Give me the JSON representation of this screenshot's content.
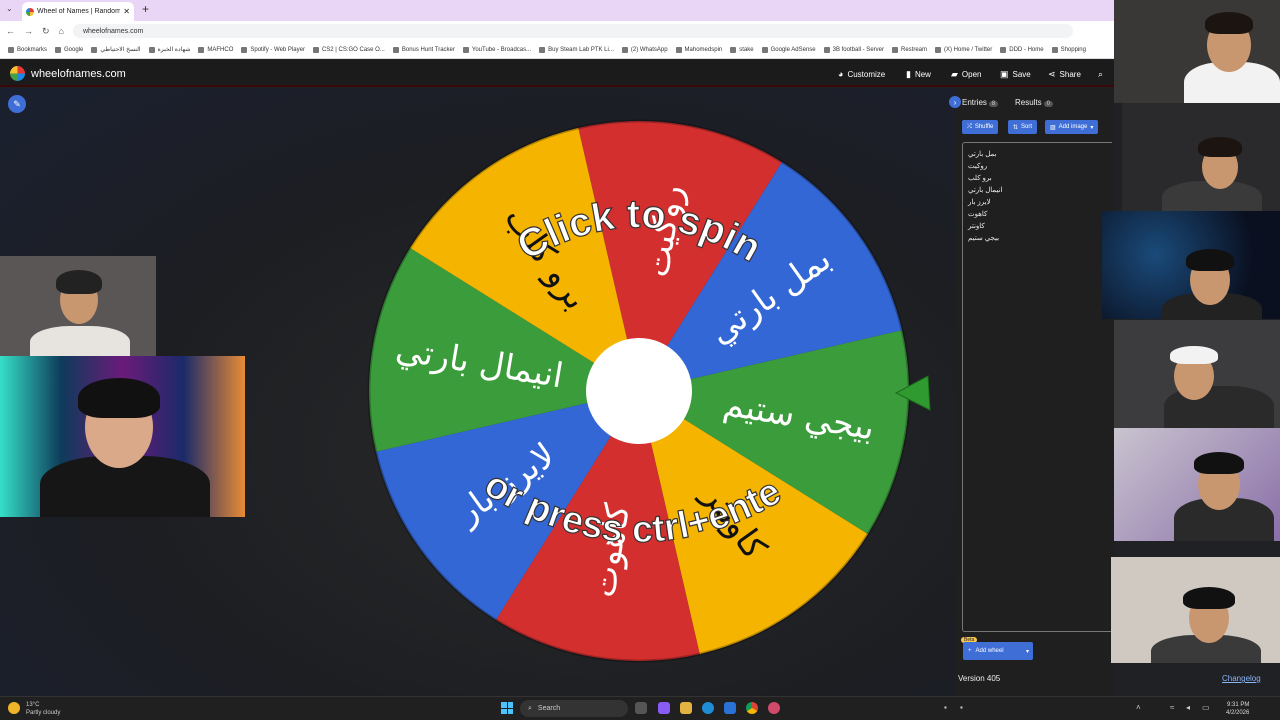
{
  "browser": {
    "tab_title": "Wheel of Names | Random nam",
    "tab_close": "✕",
    "new_tab": "+",
    "url": "wheelofnames.com",
    "bookmarks": [
      "Bookmarks",
      "Google",
      "النسخ الاحتياطي",
      "شهادة الخبرة",
      "MAFHCO",
      "Spotify - Web Player",
      "CS2 | CS:GO Case O...",
      "Bonus Hunt Tracker",
      "YouTube - Broadcas...",
      "Buy Steam Lab PTK Li...",
      "(2) WhatsApp",
      "Mahomedspin",
      "stake",
      "Google AdSense",
      "3B football - Server",
      "Restream",
      "(X) Home / Twitter",
      "DDD - Home",
      "Shopping"
    ]
  },
  "app": {
    "brand": "wheelofnames.com",
    "menu": {
      "customize": "Customize",
      "new": "New",
      "open": "Open",
      "save": "Save",
      "share": "Share"
    }
  },
  "wheel": {
    "center_prompt_line1": "Click to spin",
    "center_prompt_line2": "or press ctrl+enter",
    "segments": [
      {
        "label": "روكيت",
        "color": "#d32f2f"
      },
      {
        "label": "بمل بارتي",
        "color": "#3367d6"
      },
      {
        "label": "بيجي ستيم",
        "color": "#3b9c3b"
      },
      {
        "label": "كاونتر",
        "color": "#f4b400"
      },
      {
        "label": "كاهوت",
        "color": "#d32f2f"
      },
      {
        "label": "لايرز بار",
        "color": "#3367d6"
      },
      {
        "label": "انيمال بارتي",
        "color": "#3b9c3b"
      },
      {
        "label": "برو كلب",
        "color": "#f4b400"
      }
    ]
  },
  "panel": {
    "tab_entries": "Entries",
    "entries_count": "8",
    "tab_results": "Results",
    "results_count": "0",
    "shuffle": "Shuffle",
    "sort": "Sort",
    "add_image": "Add image",
    "entries": [
      "بمل بارتي",
      "روكيت",
      "برو كلب",
      "انيمال بارتي",
      "لايرز بار",
      "كاهوت",
      "كاونتر",
      "بيجي ستيم"
    ],
    "beta": "Beta",
    "add_wheel": "Add wheel",
    "version": "Version 405",
    "changelog": "Changelog"
  },
  "taskbar": {
    "temp": "13°C",
    "weather": "Partly cloudy",
    "search": "Search",
    "time": "9:31 PM",
    "date": "4/2/2026"
  }
}
